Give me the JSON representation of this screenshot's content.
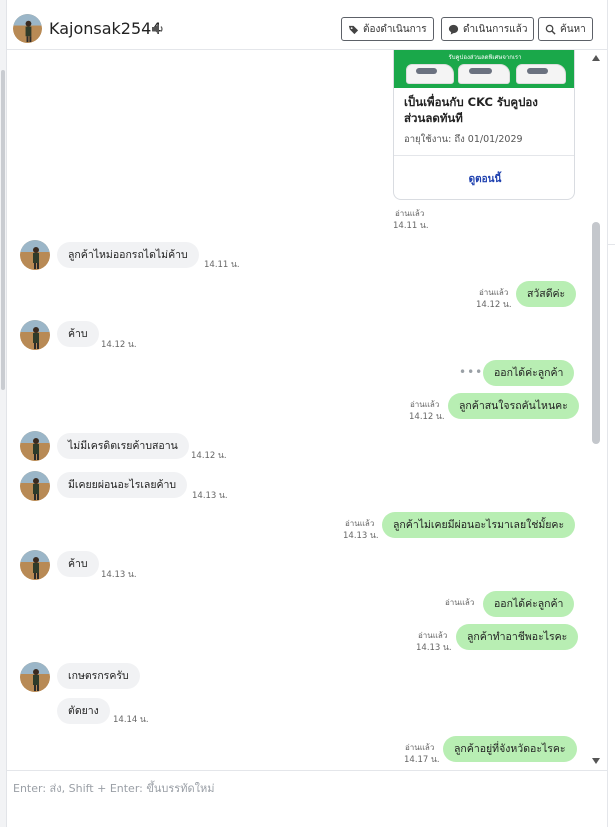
{
  "header": {
    "user_name": "Kajonsak2544",
    "buttons": [
      {
        "label": "ต้องดำเนินการ",
        "icon": "tag-icon"
      },
      {
        "label": "ดำเนินการแล้ว",
        "icon": "chat-bubble-icon"
      },
      {
        "label": "ค้นหา",
        "icon": "search-icon"
      }
    ]
  },
  "coupon": {
    "banner_text": "รับคูปองส่วนลดพิเศษจากเรา",
    "title": "เป็นเพื่อนกับ CKC รับคูปองส่วนลดทันที",
    "expiry": "อายุใช้งาน: ถึง 01/01/2029",
    "link_label": "ดูตอนนี้"
  },
  "read_label": "อ่านแล้ว",
  "messages": [
    {
      "dir": "out-meta",
      "time": "14.11 น."
    },
    {
      "dir": "in",
      "text": "ลูกค้าไหม่ออกรถไดไม่ค้าบ",
      "time": "14.11 น."
    },
    {
      "dir": "out",
      "text": "สวัสดีค่ะ",
      "time": "14.12 น."
    },
    {
      "dir": "in",
      "text": "ค้าบ",
      "time": "14.12 น."
    },
    {
      "dir": "out",
      "text": "ออกได้ค่ะลูกค้า",
      "time": ""
    },
    {
      "dir": "out",
      "text": "ลูกค้าสนใจรถคันไหนคะ",
      "time": "14.12 น."
    },
    {
      "dir": "in",
      "text": "ไม่มีเครดิตเรยค้าบสอาน",
      "time": "14.12 น."
    },
    {
      "dir": "in",
      "text": "มีเคยยผ่อนอะไรเลยค้าบ",
      "time": "14.13 น."
    },
    {
      "dir": "out",
      "text": "ลูกค้าไม่เคยมีผ่อนอะไรมาเลยใช่มั้ยคะ",
      "time": "14.13 น."
    },
    {
      "dir": "in",
      "text": "ค้าบ",
      "time": "14.13 น."
    },
    {
      "dir": "out",
      "text": "ออกได้ค่ะลูกค้า",
      "time": ""
    },
    {
      "dir": "out",
      "text": "ลูกค้าทำอาชีพอะไรคะ",
      "time": "14.13 น."
    },
    {
      "dir": "in",
      "text": "เกษตรกรครับ",
      "time": ""
    },
    {
      "dir": "in",
      "text": "ตัดยาง",
      "time": "14.14 น."
    },
    {
      "dir": "out",
      "text": "ลูกค้าอยู่ที่จังหวัดอะไรคะ",
      "time": "14.17 น."
    }
  ],
  "composer": {
    "placeholder": "Enter: ส่ง, Shift + Enter: ขึ้นบรรทัดใหม่"
  },
  "colors": {
    "outgoing_bubble": "#b8eeb3",
    "incoming_bubble": "#f1f2f4",
    "banner_green": "#1aa84a",
    "link_blue": "#1e40af"
  }
}
